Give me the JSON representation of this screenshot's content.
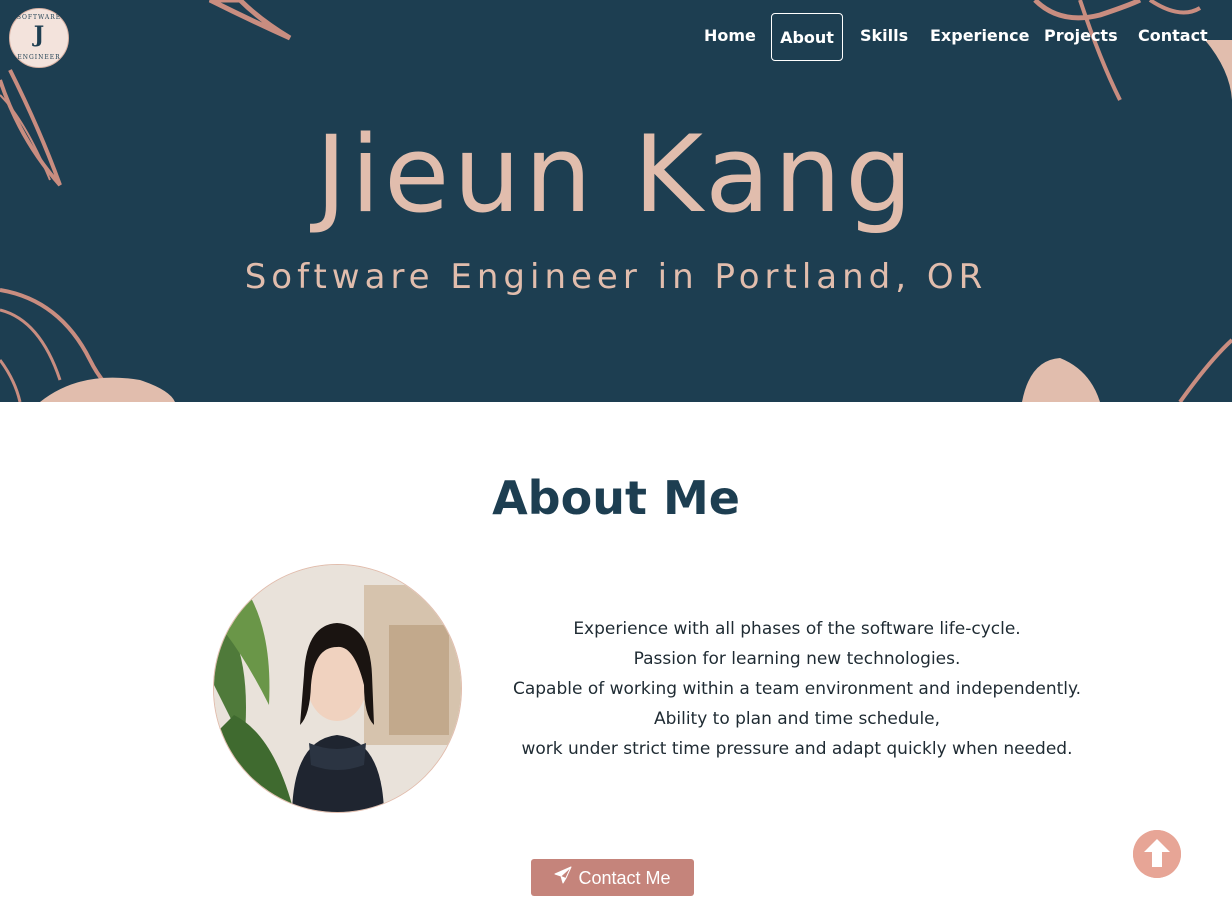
{
  "logo": {
    "letter": "J",
    "ring_top": "SOFTWARE",
    "ring_bottom": "ENGINEER"
  },
  "nav": {
    "items": [
      {
        "label": "Home"
      },
      {
        "label": "About"
      },
      {
        "label": "Skills"
      },
      {
        "label": "Experience"
      },
      {
        "label": "Projects"
      },
      {
        "label": "Contact"
      }
    ],
    "active": "About"
  },
  "hero": {
    "title": "Jieun Kang",
    "subtitle": "Software Engineer in Portland, OR"
  },
  "about": {
    "heading": "About Me",
    "lines": [
      "Experience with all phases of the software life-cycle.",
      "Passion for learning new technologies.",
      "Capable of working within a team environment and independently.",
      "Ability to plan and time schedule,",
      "work under strict time pressure and adapt quickly when needed."
    ],
    "contact_button": "Contact Me"
  },
  "colors": {
    "hero_bg": "#1d3e51",
    "accent_pink": "#e1bdad",
    "button_bg": "#c5847b",
    "heading": "#1d3e51"
  },
  "icons": {
    "contact_button_icon": "paper-plane-icon",
    "back_to_top": "arrow-up-circle-icon"
  }
}
